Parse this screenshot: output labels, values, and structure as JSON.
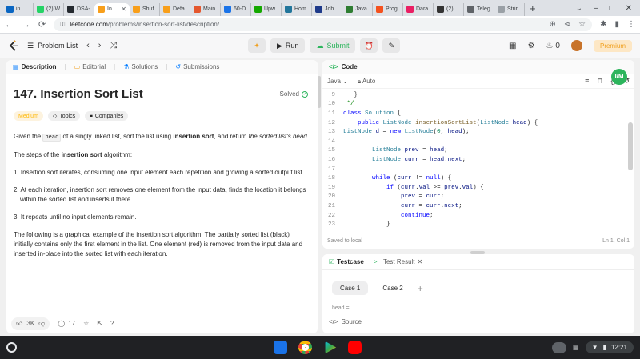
{
  "browser": {
    "tabs": [
      {
        "label": "in",
        "color": "#0a66c2",
        "active": false
      },
      {
        "label": "(2) W",
        "color": "#25d366",
        "active": false
      },
      {
        "label": "DSA-",
        "color": "#24292f",
        "active": false
      },
      {
        "label": "In",
        "color": "#f89f1b",
        "active": true
      },
      {
        "label": "Shuf",
        "color": "#f89f1b",
        "active": false
      },
      {
        "label": "Defa",
        "color": "#f89f1b",
        "active": false
      },
      {
        "label": "Main",
        "color": "#e4572e",
        "active": false
      },
      {
        "label": "60-D",
        "color": "#1a73e8",
        "active": false
      },
      {
        "label": "Upw",
        "color": "#14a800",
        "active": false
      },
      {
        "label": "Hom",
        "color": "#21759b",
        "active": false
      },
      {
        "label": "Job",
        "color": "#1e3a8a",
        "active": false
      },
      {
        "label": "Java",
        "color": "#2e7d32",
        "active": false
      },
      {
        "label": "Prog",
        "color": "#f4511e",
        "active": false
      },
      {
        "label": "Dara",
        "color": "#e91e63",
        "active": false
      },
      {
        "label": "(2)",
        "color": "#333333",
        "active": false
      },
      {
        "label": "Teleg",
        "color": "#5f6368",
        "active": false
      },
      {
        "label": "Strin",
        "color": "#9aa0a6",
        "active": false
      }
    ],
    "url_host": "leetcode.com",
    "url_path": "/problems/insertion-sort-list/description/"
  },
  "topbar": {
    "problem_list": "Problem List",
    "run": "Run",
    "submit": "Submit",
    "streak": "0",
    "premium": "Premium"
  },
  "left_tabs": [
    "Description",
    "Editorial",
    "Solutions",
    "Submissions"
  ],
  "problem": {
    "title": "147. Insertion Sort List",
    "status": "Solved",
    "difficulty": "Medium",
    "topics": "Topics",
    "companies": "Companies",
    "p1_a": "Given the ",
    "p1_code": "head",
    "p1_b": " of a singly linked list, sort the list using ",
    "p1_bold": "insertion sort",
    "p1_c": ", and return ",
    "p1_em": "the sorted list's head",
    "p1_d": ".",
    "p2_a": "The steps of the ",
    "p2_bold": "insertion sort",
    "p2_b": " algorithm:",
    "steps": [
      "1. Insertion sort iterates, consuming one input element each repetition and growing a sorted output list.",
      "2. At each iteration, insertion sort removes one element from the input data, finds the location it belongs within the sorted list and inserts it there.",
      "3. It repeats until no input elements remain."
    ],
    "p3": "The following is a graphical example of the insertion sort algorithm. The partially sorted list (black) initially contains only the first element in the list. One element (red) is removed from the input data and inserted in-place into the sorted list with each iteration."
  },
  "left_footer": {
    "likes": "3K",
    "comments": "17"
  },
  "code_panel": {
    "tab": "Code",
    "language": "Java",
    "mode": "Auto",
    "saved": "Saved to local",
    "cursor": "Ln 1, Col 1"
  },
  "code_lines": [
    {
      "n": "9",
      "t": "   }"
    },
    {
      "n": "10",
      "t": " */"
    },
    {
      "n": "11",
      "t": "class Solution {"
    },
    {
      "n": "12",
      "t": "    public ListNode insertionSortList(ListNode head) {"
    },
    {
      "n": "13",
      "t": "ListNode d = new ListNode(0, head);"
    },
    {
      "n": "14",
      "t": ""
    },
    {
      "n": "15",
      "t": "        ListNode prev = head;"
    },
    {
      "n": "16",
      "t": "        ListNode curr = head.next;"
    },
    {
      "n": "17",
      "t": ""
    },
    {
      "n": "18",
      "t": "        while (curr != null) {"
    },
    {
      "n": "19",
      "t": "            if (curr.val >= prev.val) {"
    },
    {
      "n": "20",
      "t": "                prev = curr;"
    },
    {
      "n": "21",
      "t": "                curr = curr.next;"
    },
    {
      "n": "22",
      "t": "                continue;"
    },
    {
      "n": "23",
      "t": "            }"
    }
  ],
  "testcase": {
    "tab1": "Testcase",
    "tab2": "Test Result",
    "cases": [
      "Case 1",
      "Case 2"
    ],
    "head_label": "head =",
    "source": "Source"
  },
  "floating": "I/M",
  "taskbar": {
    "time": "12:21"
  }
}
